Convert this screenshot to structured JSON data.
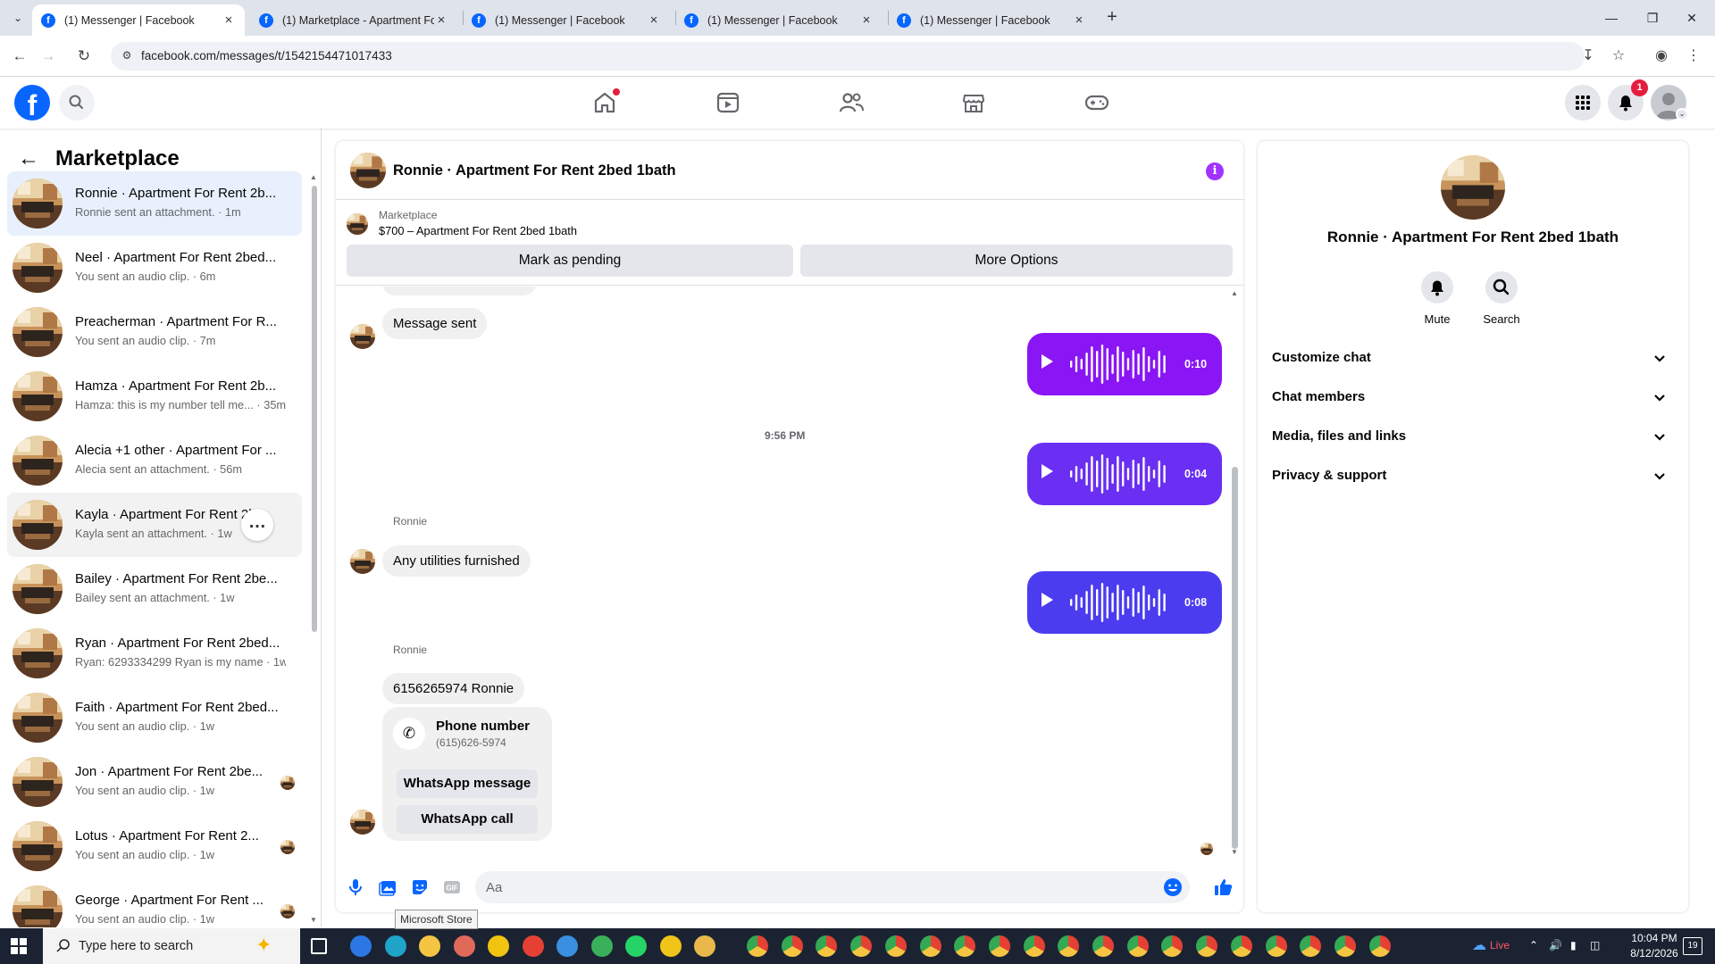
{
  "browser": {
    "tabs": [
      {
        "title": "(1) Messenger | Facebook",
        "active": true
      },
      {
        "title": "(1) Marketplace - Apartment Fo",
        "active": false
      },
      {
        "title": "(1) Messenger | Facebook",
        "active": false
      },
      {
        "title": "(1) Messenger | Facebook",
        "active": false
      },
      {
        "title": "(1) Messenger | Facebook",
        "active": false
      }
    ],
    "url": "facebook.com/messages/t/1542154471017433"
  },
  "fbnav": {
    "notification_count": "1"
  },
  "sidebar": {
    "title": "Marketplace",
    "conversations": [
      {
        "name": "Ronnie · Apartment For Rent 2b...",
        "preview": "Ronnie sent an attachment. · 1m"
      },
      {
        "name": "Neel · Apartment For Rent 2bed...",
        "preview": "You sent an audio clip. · 6m"
      },
      {
        "name": "Preacherman · Apartment For R...",
        "preview": "You sent an audio clip. · 7m"
      },
      {
        "name": "Hamza · Apartment For Rent 2b...",
        "preview": "Hamza: this is my number tell me... · 35m"
      },
      {
        "name": "Alecia +1 other · Apartment For ...",
        "preview": "Alecia sent an attachment. · 56m"
      },
      {
        "name": "Kayla · Apartment For Rent 2b",
        "preview": "Kayla sent an attachment. · 1w"
      },
      {
        "name": "Bailey · Apartment For Rent 2be...",
        "preview": "Bailey sent an attachment. · 1w"
      },
      {
        "name": "Ryan · Apartment For Rent 2bed...",
        "preview": "Ryan: 6293334299 Ryan is my name · 1w"
      },
      {
        "name": "Faith · Apartment For Rent 2bed...",
        "preview": "You sent an audio clip. · 1w"
      },
      {
        "name": "Jon · Apartment For Rent 2be...",
        "preview": "You sent an audio clip. · 1w"
      },
      {
        "name": "Lotus · Apartment For Rent 2...",
        "preview": "You sent an audio clip. · 1w"
      },
      {
        "name": "George · Apartment For Rent ...",
        "preview": "You sent an audio clip. · 1w"
      }
    ]
  },
  "chat": {
    "title": "Ronnie · Apartment For Rent 2bed 1bath",
    "listing": {
      "kicker": "Marketplace",
      "title": "$700 – Apartment For Rent 2bed 1bath",
      "mark_pending": "Mark as pending",
      "more_options": "More Options"
    },
    "messages": {
      "m1": "Message sent",
      "audio1": "0:10",
      "time1": "9:56 PM",
      "audio2": "0:04",
      "sender1": "Ronnie",
      "m2": "Any utilities furnished",
      "audio3": "0:08",
      "sender2": "Ronnie",
      "m3": "6156265974 Ronnie",
      "card_label": "Phone number",
      "card_number": "(615)626-5974",
      "whatsapp_message": "WhatsApp message",
      "whatsapp_call": "WhatsApp call"
    },
    "composer_placeholder": "Aa",
    "tooltip": "Microsoft Store"
  },
  "info": {
    "name": "Ronnie · Apartment For Rent 2bed 1bath",
    "mute": "Mute",
    "search": "Search",
    "sections": [
      "Customize chat",
      "Chat members",
      "Media, files and links",
      "Privacy & support"
    ]
  },
  "taskbar": {
    "search_placeholder": "Type here to search",
    "live": "Live",
    "time": "10:04 PM",
    "date": "8/12/2026",
    "notifications": "19"
  },
  "colors": {
    "fb_blue": "#0866ff",
    "audio_purple": "#8a16f5",
    "audio_indigo": "#6a2ff2",
    "audio_blue": "#4b3cf0"
  }
}
